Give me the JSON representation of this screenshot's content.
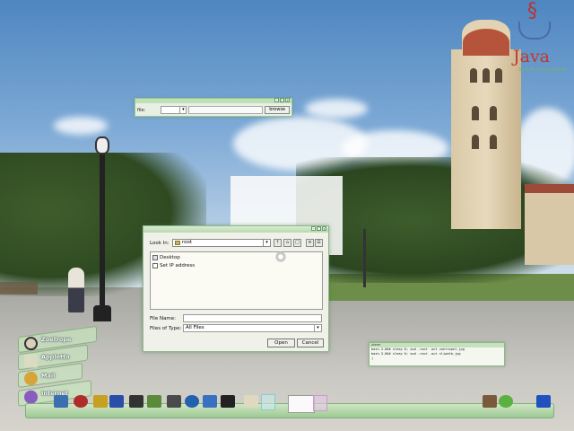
{
  "desktop": {
    "logo": {
      "text": "Java",
      "subtext": "Sun Microsystems"
    }
  },
  "file_bar": {
    "label": "file:",
    "path_value": "",
    "browse_label": "browse"
  },
  "open_dialog": {
    "look_in_label": "Look In:",
    "look_in_value": "root",
    "toolbar": {
      "up": "↑",
      "home": "⌂",
      "new_folder": "□",
      "list": "≡",
      "details": "☰"
    },
    "files": [
      {
        "name": "Desktop",
        "icon": "folder-icon"
      },
      {
        "name": "Set IP address",
        "icon": "file-icon"
      }
    ],
    "file_name_label": "File Name:",
    "file_name_value": "",
    "files_of_type_label": "Files of Type:",
    "files_of_type_value": "All Files",
    "open_label": "Open",
    "cancel_label": "Cancel"
  },
  "terminal": {
    "title": "xterm",
    "lines": [
      "bash-3.00# sleep 6; xwd -root -out zoetrope1.jpg",
      "bash-3.00# sleep 6; xwd -root -out slipmtb.jpg",
      "|"
    ]
  },
  "launcher": {
    "items": [
      {
        "label": "Zoetrope",
        "icon": "film-reel-icon",
        "color": "#d8d0b8"
      },
      {
        "label": "Appletto",
        "icon": "leaf-icon",
        "color": "#d9dcc2"
      },
      {
        "label": "Mail",
        "icon": "mail-icon",
        "color": "#d6a43a"
      },
      {
        "label": "Internet",
        "icon": "globe-icon",
        "color": "#8a5cc2"
      }
    ]
  },
  "dock": {
    "items": [
      {
        "name": "laptop-icon",
        "color": "#3c6fb0"
      },
      {
        "name": "cd-icon",
        "color": "#b02c2c"
      },
      {
        "name": "pencil-icon",
        "color": "#c8a020"
      },
      {
        "name": "monitor-icon",
        "color": "#2a4ea8"
      },
      {
        "name": "tux-icon",
        "color": "#333333"
      },
      {
        "name": "system-monitor-icon",
        "color": "#5a8a3a"
      },
      {
        "name": "keyboard-icon",
        "color": "#4a4a4a"
      },
      {
        "name": "earth-icon",
        "color": "#2460b0"
      },
      {
        "name": "star-app-icon",
        "color": "#3a70c0"
      },
      {
        "name": "pirate-flag-icon",
        "color": "#222222"
      },
      {
        "name": "wand-icon",
        "color": "#e0d8c0"
      },
      {
        "name": "lamp-icon",
        "color": "#7a5a3a"
      },
      {
        "name": "leaf-app-icon",
        "color": "#5ab040"
      },
      {
        "name": "blue-star-icon",
        "color": "#2050c0"
      }
    ]
  }
}
